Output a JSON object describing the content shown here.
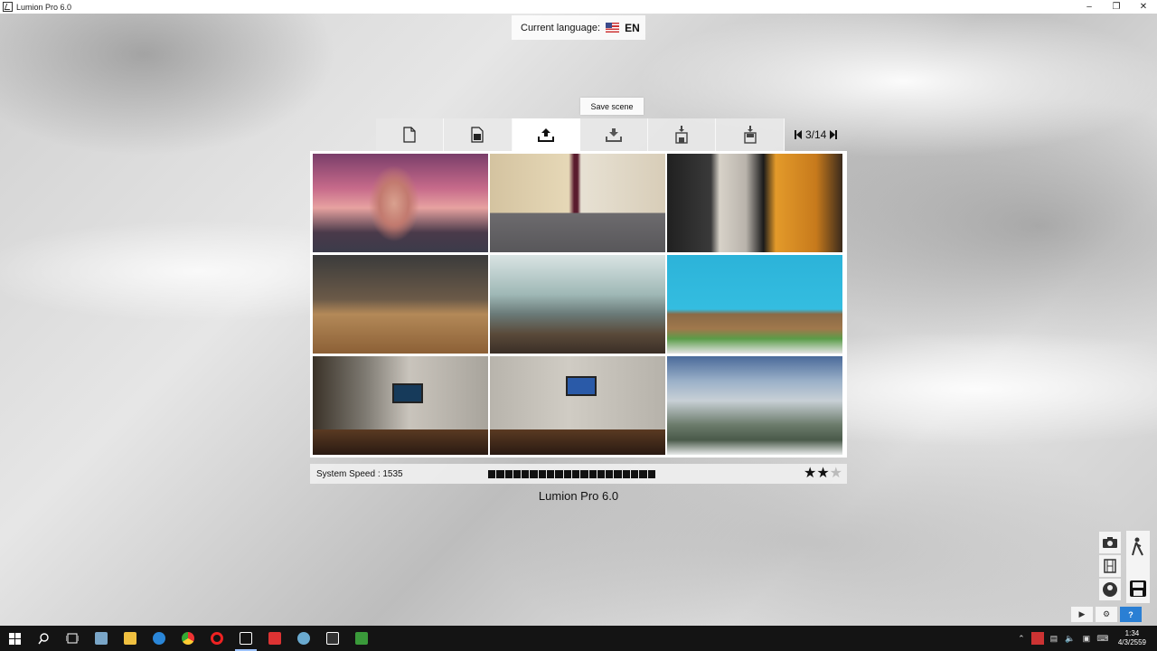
{
  "window": {
    "title": "Lumion Pro 6.0",
    "minimize": "–",
    "restore": "❐",
    "close": "✕"
  },
  "language": {
    "label": "Current language:",
    "code": "EN"
  },
  "tooltip": {
    "text": "Save scene"
  },
  "toolbar": {
    "tabs": [
      {
        "icon": "new-scene-icon"
      },
      {
        "icon": "open-scene-icon"
      },
      {
        "icon": "import-scene-icon",
        "active": true
      },
      {
        "icon": "save-scene-icon"
      },
      {
        "icon": "save-as-icon"
      },
      {
        "icon": "load-file-icon"
      }
    ],
    "page": "3/14"
  },
  "thumbnails": [
    {
      "name": "beach-scene"
    },
    {
      "name": "bedroom-scene"
    },
    {
      "name": "modern-kitchen-scene"
    },
    {
      "name": "studio-scene"
    },
    {
      "name": "glass-house-scene"
    },
    {
      "name": "blue-kitchen-scene"
    },
    {
      "name": "living-room-scene-1"
    },
    {
      "name": "living-room-scene-2"
    },
    {
      "name": "exterior-scene"
    }
  ],
  "status": {
    "system_speed": "System Speed : 1535",
    "speed_blocks": 20,
    "stars": 2,
    "stars_max": 3
  },
  "product": {
    "name": "Lumion Pro 6.0"
  },
  "clock": {
    "time": "1:34",
    "date": "4/3/2559"
  },
  "colors": {
    "help": "#2a7fd4",
    "taskbar": "#141414"
  }
}
